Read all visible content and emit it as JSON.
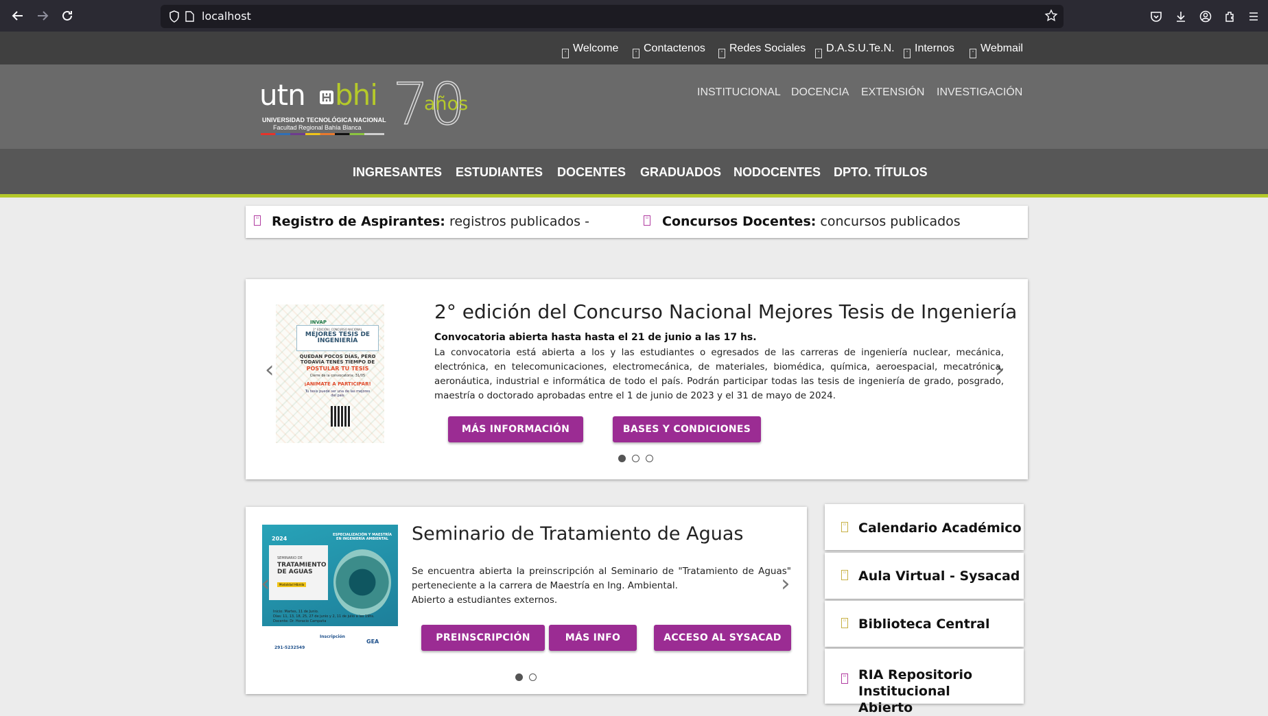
{
  "browser": {
    "url": "localhost"
  },
  "topbar": {
    "links": [
      {
        "label": "Welcome"
      },
      {
        "label": "Contactenos"
      },
      {
        "label": "Redes Sociales"
      },
      {
        "label": "D.A.S.U.Te.N."
      },
      {
        "label": "Internos"
      },
      {
        "label": "Webmail"
      }
    ]
  },
  "header": {
    "logo": {
      "utn": "utn",
      "bhi": "bhi",
      "years_number": "70",
      "years_word": "años",
      "line1": "UNIVERSIDAD TECNOLÓGICA NACIONAL",
      "line2": "Facultad Regional Bahía Blanca"
    },
    "main_links": [
      {
        "label": "INSTITUCIONAL"
      },
      {
        "label": "DOCENCIA"
      },
      {
        "label": "EXTENSIÓN"
      },
      {
        "label": "INVESTIGACIÓN"
      }
    ]
  },
  "navbar": {
    "items": [
      {
        "label": "INGRESANTES"
      },
      {
        "label": "ESTUDIANTES"
      },
      {
        "label": "DOCENTES"
      },
      {
        "label": "GRADUADOS"
      },
      {
        "label": "NODOCENTES"
      },
      {
        "label": "DPTO. TÍTULOS"
      }
    ]
  },
  "ticker": {
    "items": [
      {
        "title": "Registro de Aspirantes:",
        "text": "registros publicados -"
      },
      {
        "title": "Concursos Docentes:",
        "text": "concursos publicados"
      }
    ]
  },
  "featured": {
    "title": "2° edición del Concurso Nacional Mejores Tesis de Ingeniería",
    "subtitle": "Convocatoria abierta hasta hasta el 21 de junio a las 17 hs.",
    "body": "La convocatoria está abierta a los y las estudiantes o egresados de las carreras de ingeniería nuclear, mecánica, electrónica, en telecomunicaciones, electromecánica, de materiales, biomédica, química, aeroespacial, mecatrónica, aeronáutica, industrial e informática de todo el país. Podrán participar todas las tesis de ingeniería de grado, posgrado, maestría o doctorado aprobadas entre el 1 de junio de 2023 y el 31 de mayo de 2024.",
    "buttons": [
      {
        "label": "MÁS INFORMACIÓN"
      },
      {
        "label": "BASES Y CONDICIONES"
      }
    ],
    "poster": {
      "brand": "INVAP",
      "edition": "2° EDICIÓN | CONCURSO NACIONAL",
      "heading": "MEJORES TESIS DE INGENIERÍA",
      "line1": "QUEDAN POCOS DÍAS, PERO TODAVÍA TENÉS TIEMPO DE",
      "line2": "POSTULAR TU TESIS",
      "line3": "Cierre de la convocatoria: 31/05",
      "line4": "¡ANIMATE A PARTICIPAR!",
      "line5": "Tu tesis puede ser una de las mejores del país"
    },
    "slides_total": 3,
    "active_slide": 1
  },
  "seminar": {
    "title": "Seminario de Tratamiento de Aguas",
    "body_line1": "Se encuentra abierta la preinscripción al Seminario de \"Tratamiento de Aguas\" perteneciente a la carrera de Maestría en Ing. Ambiental.",
    "body_line2": "Abierto a estudiantes externos.",
    "buttons": [
      {
        "label": "PREINSCRIPCIÓN"
      },
      {
        "label": "MÁS INFO"
      },
      {
        "label": "ACCESO AL SYSACAD"
      }
    ],
    "poster": {
      "year": "2024",
      "program": "ESPECIALIZACIÓN Y MAESTRÍA EN INGENIERÍA AMBIENTAL",
      "label": "SEMINARIO DE",
      "heading": "TRATAMIENTO DE AGUAS",
      "modality": "Modalidad Híbrida",
      "schedule1": "Inicio: Martes, 11 de Junio.",
      "schedule2": "Días: 11, 13, 18, 25, 27 de junio y 2, 11 de julio a las 19hs.",
      "teacher": "Docente: Dr. Horacio Campaña",
      "inscripcion": "Inscripción",
      "phone": "291-5232549",
      "org": "GEA"
    },
    "slides_total": 2,
    "active_slide": 1
  },
  "sidebar": {
    "items": [
      {
        "label": "Calendario Académico"
      },
      {
        "label": "Aula Virtual - Sysacad"
      },
      {
        "label": "Biblioteca Central"
      },
      {
        "label": "RIA Repositorio Institucional Abierto"
      }
    ]
  },
  "colors": {
    "accent_purple": "#9b2c93",
    "accent_lime": "#b5c92a",
    "header_gray": "#6a6a6a",
    "nav_gray": "#575757",
    "topbar_gray": "#404040"
  }
}
